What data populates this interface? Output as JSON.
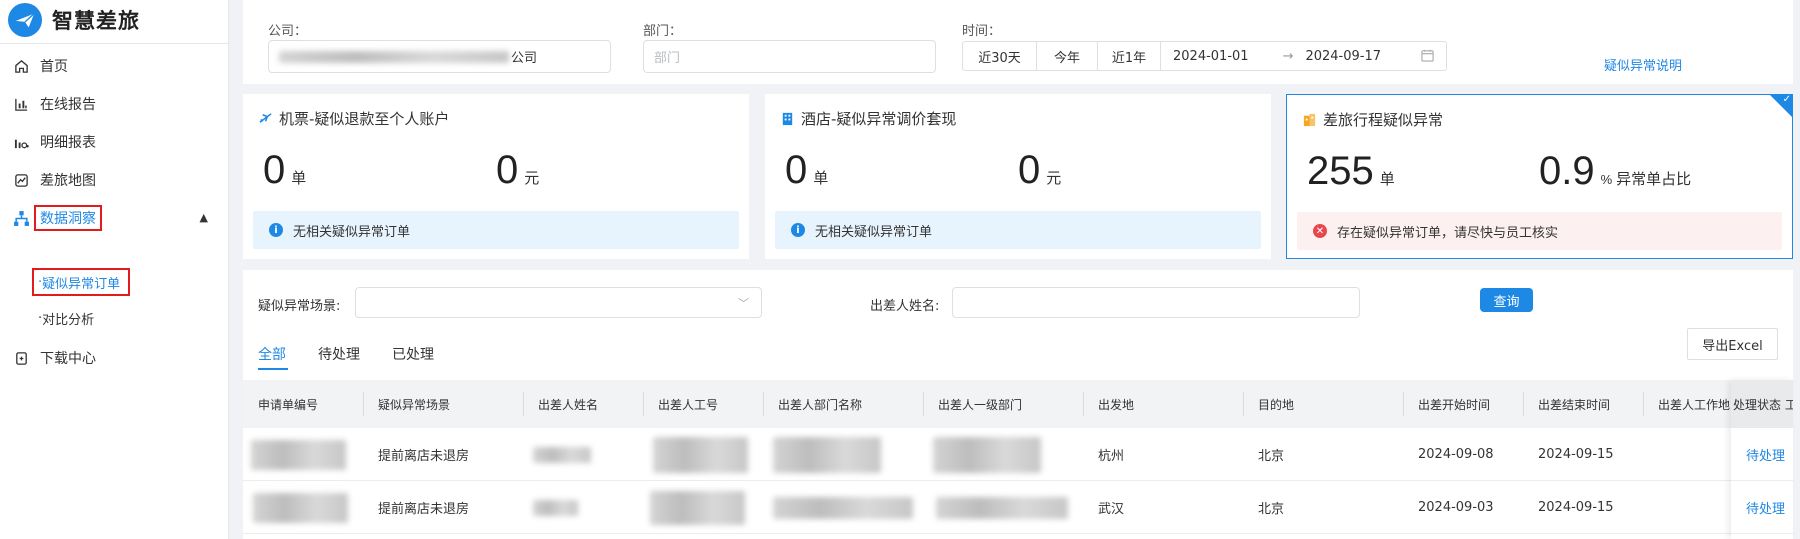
{
  "app": {
    "name": "智慧差旅"
  },
  "sidebar": {
    "items": [
      {
        "label": "首页",
        "icon": "home-icon"
      },
      {
        "label": "在线报告",
        "icon": "bar-chart-icon"
      },
      {
        "label": "明细报表",
        "icon": "column-chart-icon"
      },
      {
        "label": "差旅地图",
        "icon": "map-icon"
      },
      {
        "label": "数据洞察",
        "icon": "org-chart-icon",
        "expanded": true
      },
      {
        "label": "下载中心",
        "icon": "download-icon"
      }
    ],
    "sub_items": [
      "疑似异常订单",
      "对比分析"
    ],
    "sub_prefix": "·"
  },
  "filters": {
    "company_label": "公司：",
    "company_value": "公司",
    "dept_label": "部门：",
    "dept_placeholder": "部门",
    "time_label": "时间：",
    "quick_ranges": [
      "近30天",
      "今年",
      "近1年"
    ],
    "date_start": "2024-01-01",
    "date_sep": "→",
    "date_end": "2024-09-17",
    "help_link": "疑似异常说明"
  },
  "cards": [
    {
      "title": "机票-疑似退款至个人账户",
      "count": "0",
      "count_unit": "单",
      "amount": "0",
      "amount_unit": "元",
      "notice": "无相关疑似异常订单",
      "notice_type": "info"
    },
    {
      "title": "酒店-疑似异常调价套现",
      "count": "0",
      "count_unit": "单",
      "amount": "0",
      "amount_unit": "元",
      "notice": "无相关疑似异常订单",
      "notice_type": "info"
    },
    {
      "title": "差旅行程疑似异常",
      "count": "255",
      "count_unit": "单",
      "amount": "0.9",
      "amount_unit": "%",
      "amount_suffix": "异常单占比",
      "notice": "存在疑似异常订单，请尽快与员工核实",
      "notice_type": "error",
      "selected": true
    }
  ],
  "query": {
    "scene_label": "疑似异常场景:",
    "traveler_label": "出差人姓名:",
    "search_button": "查询",
    "export_button": "导出Excel"
  },
  "tabs": [
    "全部",
    "待处理",
    "已处理"
  ],
  "active_tab": 0,
  "table": {
    "columns": [
      "申请单编号",
      "疑似异常场景",
      "出差人姓名",
      "出差人工号",
      "出差人部门名称",
      "出差人一级部门",
      "出发地",
      "目的地",
      "出差开始时间",
      "出差结束时间",
      "出差人工作地",
      "处理状态"
    ],
    "fixed_header_text": "处理状态 工",
    "rows": [
      {
        "scene": "提前离店未退房",
        "from": "杭州",
        "to": "北京",
        "start": "2024-09-08",
        "end": "2024-09-15",
        "status": "待处理"
      },
      {
        "scene": "提前离店未退房",
        "from": "武汉",
        "to": "北京",
        "start": "2024-09-03",
        "end": "2024-09-15",
        "status": "待处理"
      }
    ]
  },
  "colors": {
    "accent": "#1e88e5",
    "highlight_box": "#e21c1c",
    "error": "#e5484d"
  }
}
